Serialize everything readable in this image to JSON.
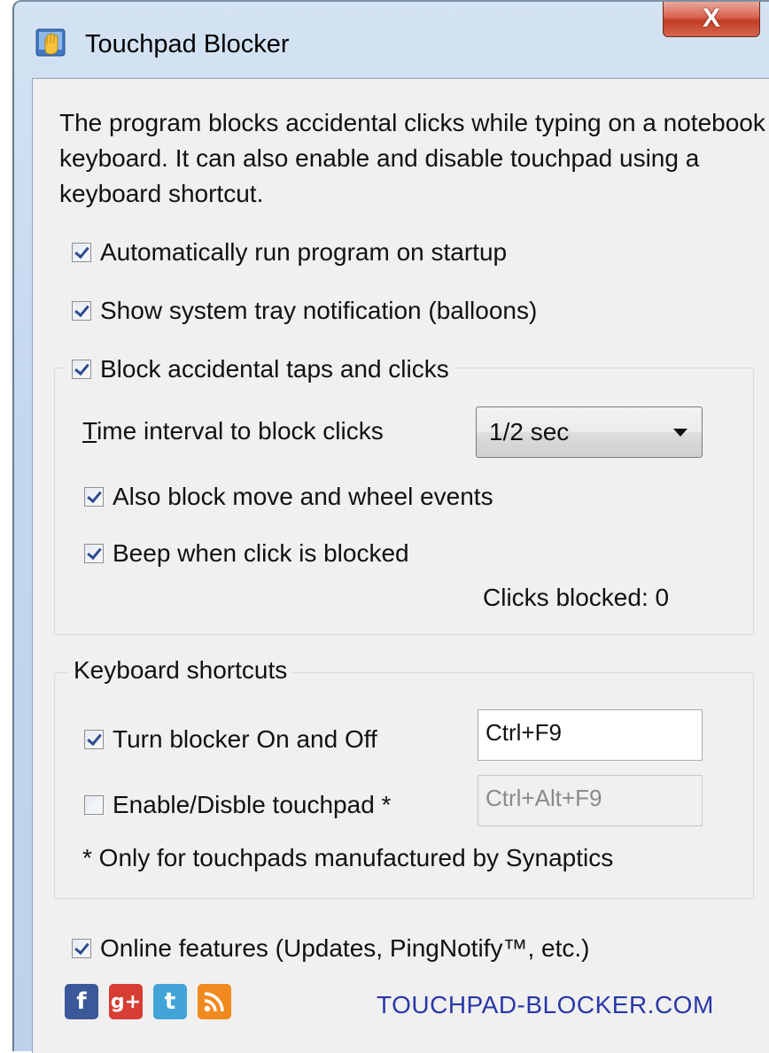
{
  "window": {
    "title": "Touchpad Blocker",
    "close_glyph": "X"
  },
  "description": "The program blocks accidental clicks while typing on a notebook keyboard. It can also enable and disable touchpad using a keyboard shortcut.",
  "options": {
    "autorun": {
      "label": "Automatically run program on startup",
      "checked": true
    },
    "tray_notification": {
      "label": "Show system tray notification (balloons)",
      "checked": true
    },
    "block_taps": {
      "label": "Block accidental taps and clicks",
      "checked": true
    }
  },
  "block_group": {
    "interval_label_prefix": "T",
    "interval_label_rest": "ime interval to block clicks",
    "interval_value": "1/2 sec",
    "block_move": {
      "label": "Also block move and wheel events",
      "checked": true
    },
    "beep": {
      "label": "Beep when click is blocked",
      "checked": true
    },
    "clicks_blocked": "Clicks blocked: 0"
  },
  "shortcuts_group": {
    "title": "Keyboard shortcuts",
    "toggle_blocker": {
      "label": "Turn blocker On and Off",
      "checked": true,
      "shortcut": "Ctrl+F9"
    },
    "toggle_touchpad": {
      "label": "Enable/Disble touchpad *",
      "checked": false,
      "shortcut": "Ctrl+Alt+F9"
    },
    "note": "* Only for touchpads manufactured by Synaptics"
  },
  "online": {
    "label": "Online features (Updates, PingNotify™, etc.)",
    "checked": true
  },
  "social": [
    {
      "name": "facebook-icon",
      "glyph": "f",
      "color": "#3b5998"
    },
    {
      "name": "google-plus-icon",
      "glyph": "g+",
      "color": "#d73d32"
    },
    {
      "name": "twitter-icon",
      "glyph": "t",
      "color": "#41a3d8"
    },
    {
      "name": "rss-icon",
      "glyph": "",
      "color": "#f08a1f"
    }
  ],
  "website": "TOUCHPAD-BLOCKER.COM"
}
